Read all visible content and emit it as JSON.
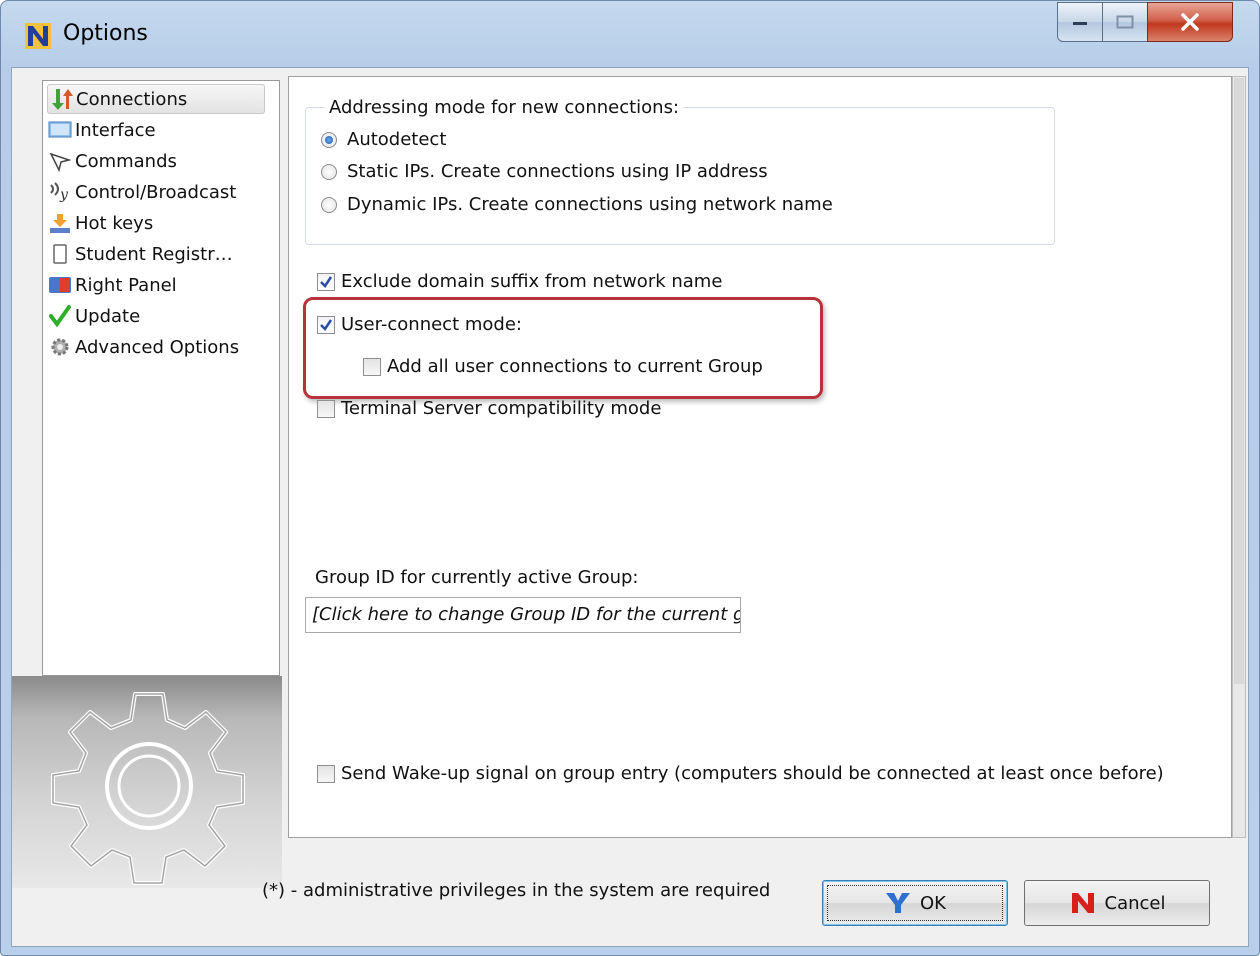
{
  "window": {
    "title": "Options"
  },
  "sidebar": {
    "items": [
      {
        "label": "Connections",
        "icon": "connections-arrows-icon",
        "selected": true
      },
      {
        "label": "Interface",
        "icon": "monitor-icon"
      },
      {
        "label": "Commands",
        "icon": "cursor-icon"
      },
      {
        "label": "Control/Broadcast",
        "icon": "broadcast-icon"
      },
      {
        "label": "Hot keys",
        "icon": "hot-keys-icon"
      },
      {
        "label": "Student Registr…",
        "icon": "document-icon"
      },
      {
        "label": "Right Panel",
        "icon": "right-panel-icon"
      },
      {
        "label": "Update",
        "icon": "checkmark-icon"
      },
      {
        "label": "Advanced Options",
        "icon": "gear-icon"
      }
    ]
  },
  "connections": {
    "addressing_legend": "Addressing mode for new connections:",
    "addressing_options": [
      {
        "label": "Autodetect",
        "checked": true
      },
      {
        "label": "Static IPs. Create connections using IP address",
        "checked": false
      },
      {
        "label": "Dynamic IPs. Create connections using network name",
        "checked": false
      }
    ],
    "exclude_domain": {
      "label": "Exclude domain suffix from network name",
      "checked": true
    },
    "user_connect": {
      "label": "User-connect mode:",
      "checked": true
    },
    "add_user_connections": {
      "label": "Add all user connections to current Group",
      "checked": false
    },
    "terminal_server": {
      "label": "Terminal Server compatibility mode",
      "checked": false
    },
    "group_id_label": "Group ID for currently active Group:",
    "group_id_value": "[Click here to change Group ID for the current gi",
    "wake_up": {
      "label": "Send Wake-up signal on group entry (computers should be connected at least once before)",
      "checked": false
    }
  },
  "footer": {
    "note": "(*) - administrative privileges in the system are required",
    "ok_label": "OK",
    "cancel_label": "Cancel"
  },
  "colors": {
    "highlight_border": "#b7323a",
    "title_bar": "#c5d9ef",
    "close_button": "#c0381d"
  }
}
